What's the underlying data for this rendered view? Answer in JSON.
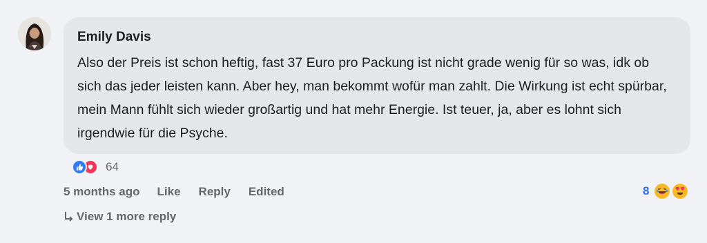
{
  "comment": {
    "author": "Emily Davis",
    "text": "Also der Preis ist schon heftig, fast 37 Euro pro Packung ist nicht grade wenig für so was, idk ob sich das jeder leisten kann. Aber hey, man bekommt wofür man zahlt. Die Wirkung ist echt spürbar, mein Mann fühlt sich wieder großartig und hat mehr Energie. Ist teuer, ja, aber es lohnt sich irgendwie für die Psyche.",
    "reaction_count": "64",
    "reaction_icons": [
      "like-icon",
      "love-icon"
    ]
  },
  "actions": {
    "timestamp": "5 months ago",
    "like_label": "Like",
    "reply_label": "Reply",
    "edited_label": "Edited"
  },
  "reply_reactions": {
    "count": "8",
    "icons": [
      "laughing-emoji-icon",
      "heart-eyes-emoji-icon"
    ]
  },
  "replies": {
    "view_more_label": "View 1 more reply"
  },
  "colors": {
    "background": "#f0f2f5",
    "bubble": "#e4e6e9",
    "accent_blue": "#2f6fe0",
    "like_blue": "#2f7bf6",
    "love_red": "#f3365a"
  }
}
